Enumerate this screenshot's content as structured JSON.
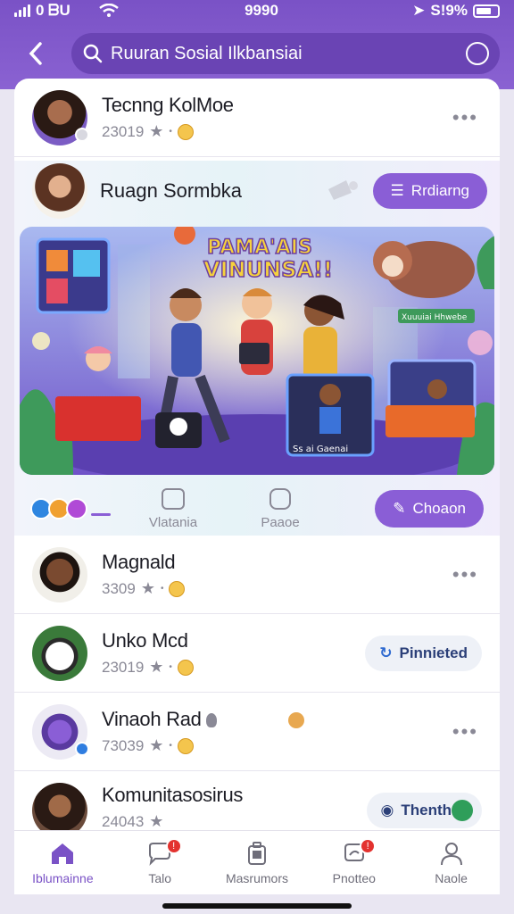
{
  "status_bar": {
    "carrier": "0 ᗷU",
    "time": "9990",
    "battery_text": "S!9%"
  },
  "header": {
    "search_query": "Ruuran Sosial Ilkbansiai"
  },
  "rows": [
    {
      "name": "Tecnng KolMoe",
      "meta": "23019"
    },
    {
      "name": "Magnald",
      "meta": "3309"
    },
    {
      "name": "Unko Mcd",
      "meta": "23019",
      "button": "Pinnieted"
    },
    {
      "name": "Vinaoh Rad",
      "meta": "73039"
    },
    {
      "name": "Komunitasosirus",
      "meta": "24043",
      "button": "Thenth"
    }
  ],
  "community": {
    "title": "Ruagn Sormbka",
    "button": "Rrdiarng",
    "banner_title_1": "PAMA'AIS",
    "banner_title_2": "VINUNSA!!",
    "banner_sign": "Xuuuiai Hhwebe",
    "banner_screen_label": "Ss ai Gaenai",
    "actions": [
      {
        "label": "Vlatania"
      },
      {
        "label": "Paaoe"
      }
    ],
    "choose_button": "Choaon"
  },
  "nav": [
    {
      "label": "Iblumainne",
      "active": true
    },
    {
      "label": "Talo",
      "badge": "!"
    },
    {
      "label": "Masrumors"
    },
    {
      "label": "Pnotteo",
      "badge": "!"
    },
    {
      "label": "Naole"
    }
  ],
  "colors": {
    "brand": "#7a52c6",
    "button": "#8a5ed6",
    "badge": "#e3322f"
  }
}
